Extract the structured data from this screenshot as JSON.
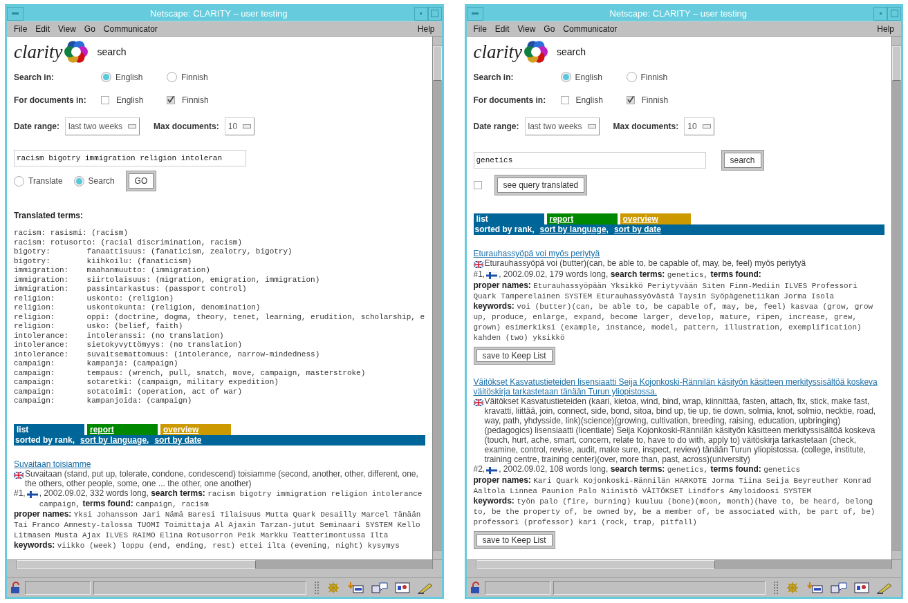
{
  "windows": [
    {
      "title": "Netscape: CLARITY – user testing",
      "menu": [
        "File",
        "Edit",
        "View",
        "Go",
        "Communicator"
      ],
      "help": "Help",
      "logo": {
        "wordmark": "clarity",
        "caption": "search"
      },
      "search_in": {
        "label": "Search in:",
        "options": [
          {
            "label": "English",
            "selected": true
          },
          {
            "label": "Finnish",
            "selected": false
          }
        ]
      },
      "documents_in": {
        "label": "For documents in:",
        "options": [
          {
            "label": "English",
            "checked": false
          },
          {
            "label": "Finnish",
            "checked": true
          }
        ]
      },
      "date_range": {
        "label": "Date range:",
        "value": "last two weeks"
      },
      "max_documents": {
        "label": "Max documents:",
        "value": "10"
      },
      "query": {
        "value": "racism bigotry immigration religion intoleran"
      },
      "mode_options": [
        {
          "label": "Translate",
          "selected": false
        },
        {
          "label": "Search",
          "selected": true
        }
      ],
      "go_button": "GO",
      "translated_terms": {
        "heading": "Translated terms:",
        "lines": [
          "racism: rasismi: (racism)",
          "racism: rotusorto: (racial discrimination, racism)",
          "bigotry:        fanaattisuus: (fanaticism, zealotry, bigotry)",
          "bigotry:        kiihkoilu: (fanaticism)",
          "immigration:    maahanmuutto: (immigration)",
          "immigration:    siirtolaisuus: (migration, emigration, immigration)",
          "immigration:    passintarkastus: (passport control)",
          "religion:       uskonto: (religion)",
          "religion:       uskontokunta: (religion, denomination)",
          "religion:       oppi: (doctrine, dogma, theory, tenet, learning, erudition, scholarship, e",
          "religion:       usko: (belief, faith)",
          "intolerance:    intoleranssi: (no translation)",
          "intolerance:    sietokyvyttömyys: (no translation)",
          "intolerance:    suvaitsemattomuus: (intolerance, narrow-mindedness)",
          "campaign:       kampanja: (campaign)",
          "campaign:       tempaus: (wrench, pull, snatch, move, campaign, masterstroke)",
          "campaign:       sotaretki: (campaign, military expedition)",
          "campaign:       sotatoimi: (operation, act of war)",
          "campaign:       kampanjoida: (campaign)"
        ]
      },
      "tabs": [
        {
          "label": "list",
          "selected": true,
          "color": "#006699"
        },
        {
          "label": "report",
          "selected": false,
          "color": "#008800"
        },
        {
          "label": "overview",
          "selected": false,
          "color": "#cc9900"
        }
      ],
      "sort_options": [
        {
          "label": "sorted by rank,",
          "selected": true
        },
        {
          "label": "sort by language,",
          "selected": false
        },
        {
          "label": "sort by date",
          "selected": false
        }
      ],
      "results": [
        {
          "title": "Suvaitaan toisiamme",
          "translation": "Suvaitaan (stand, put up, tolerate, condone, condescend) toisiamme (second, another, other, different, one, the others, other people, some, one ... the other, one another)",
          "rank": "#1,",
          "details": ", 2002.09.02, 332 words long,",
          "search_terms_label": "search terms:",
          "search_terms": "racism bigotry immigration religion intolerance campaign,",
          "terms_found_label": "terms found:",
          "terms_found": "campaign, racism",
          "proper_names_label": "proper names:",
          "proper_names": "Yksi Johansson Jari Nämä Baresi Tilaisuus Mutta Quark Desailly Marcel Tänään Tai Franco Amnesty-talossa TUOMI Toimittaja Al Ajaxin Tarzan-jutut Seminaari SYSTEM Kello Litmasen Musta Ajax ILVES RAIMO Elina Rotusorron Peik Markku Teatterimontussa Ilta",
          "keywords_label": "keywords:",
          "keywords": "viikko (week) loppu (end, ending, rest) ettei ilta (evening, night) kysymys"
        }
      ]
    },
    {
      "title": "Netscape: CLARITY – user testing",
      "menu": [
        "File",
        "Edit",
        "View",
        "Go",
        "Communicator"
      ],
      "help": "Help",
      "logo": {
        "wordmark": "clarity",
        "caption": "search"
      },
      "search_in": {
        "label": "Search in:",
        "options": [
          {
            "label": "English",
            "selected": true
          },
          {
            "label": "Finnish",
            "selected": false
          }
        ]
      },
      "documents_in": {
        "label": "For documents in:",
        "options": [
          {
            "label": "English",
            "checked": false
          },
          {
            "label": "Finnish",
            "checked": true
          }
        ]
      },
      "date_range": {
        "label": "Date range:",
        "value": "last two weeks"
      },
      "max_documents": {
        "label": "Max documents:",
        "value": "10"
      },
      "query": {
        "value": "genetics"
      },
      "search_button": "search",
      "translate_option": {
        "checked": false
      },
      "see_query_button": "see query translated",
      "tabs": [
        {
          "label": "list",
          "selected": true,
          "color": "#006699"
        },
        {
          "label": "report",
          "selected": false,
          "color": "#008800"
        },
        {
          "label": "overview",
          "selected": false,
          "color": "#cc9900"
        }
      ],
      "sort_options": [
        {
          "label": "sorted by rank,",
          "selected": true
        },
        {
          "label": "sort by language,",
          "selected": false
        },
        {
          "label": "sort by date",
          "selected": false
        }
      ],
      "results": [
        {
          "title": "Eturauhassyöpä voi myös periytyä",
          "translation": "Eturauhassyöpä voi (butter)(can, be able to, be capable of, may, be, feel) myös periytyä",
          "rank": "#1,",
          "details": ", 2002.09.02, 179 words long,",
          "search_terms_label": "search terms:",
          "search_terms": "genetics,",
          "terms_found_label": "terms found:",
          "proper_names_label": "proper names:",
          "proper_names": "Eturauhassyöpään Yksikkö Periytyvään Siten Finn-Mediin ILVES Professori Quark Tamperelainen SYSTEM Eturauhassyövästä Taysin Syöpägenetiikan Jorma Isola",
          "keywords_label": "keywords:",
          "keywords": "voi (butter)(can, be able to, be capable of, may, be, feel) kasvaa (grow, grow up, produce, enlarge, expand, become larger, develop, mature, ripen, increase, grew, grown) esimerkiksi (example, instance, model, pattern, illustration, exemplification) kahden (two) yksikkö",
          "save_button": "save to Keep List"
        },
        {
          "title": "Väitökset Kasvatustieteiden lisensiaatti Seija Kojonkoski-Rännilän käsityön käsitteen merkityssisältöä koskeva väitöskirja tarkastetaan tänään Turun yliopistossa.",
          "translation": "Väitökset Kasvatustieteiden (kaari, kietoa, wind, bind, wrap, kiinnittää, fasten, attach, fix, stick, make fast, kravatti, liittää, join, connect, side, bond, sitoa, bind up, tie up, tie down, solmia, knot, solmio, necktie, road, way, path, yhdysside, link)(science)(growing, cultivation, breeding, raising, education, upbringing)(pedagogics) lisensiaatti (licentiate) Seija Kojonkoski-Rännilän käsityön käsitteen merkityssisältöä koskeva (touch, hurt, ache, smart, concern, relate to, have to do with, apply to) väitöskirja tarkastetaan (check, examine, control, revise, audit, make sure, inspect, review) tänään Turun yliopistossa. (college, institute, training centre, training center)(over, more than, past, across)(university)",
          "rank": "#2,",
          "details": ", 2002.09.02, 108 words long,",
          "search_terms_label": "search terms:",
          "search_terms": "genetics,",
          "terms_found_label": "terms found:",
          "terms_found": "genetics",
          "proper_names_label": "proper names:",
          "proper_names": "Kari Quark Kojonkoski-Rännilän HARKOTE Jorma Tiina Seija Beyreuther Konrad Aaltola Linnea Paunion Palo Niinistö VÄITÖKSET Lindfors Amyloidoosi SYSTEM",
          "keywords_label": "keywords:",
          "keywords": "työn palo (fire, burning) kuuluu (bone)(moon, month)(have to, be heard, belong to, be the property of, be owned by, be a member of, be associated with, be part of, be) professori (professor) kari (rock, trap, pitfall)",
          "save_button": "save to Keep List"
        }
      ]
    }
  ]
}
